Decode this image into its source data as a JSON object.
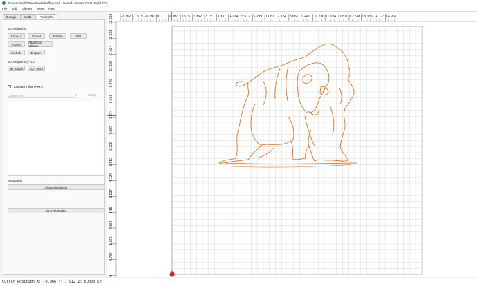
{
  "window": {
    "title": "C:\\Users\\willh\\Downloads\\buffalo.c2d - Carbide Create PRO, Build 774"
  },
  "menu": [
    "File",
    "Edit",
    "Library",
    "View",
    "Help"
  ],
  "tabs": [
    "Design",
    "Model",
    "Toolpaths"
  ],
  "toolpaths": {
    "section_2d": "2D Toolpaths",
    "buttons_2d": [
      "Contour",
      "Pocket",
      "Texture",
      "Drill",
      "VCarve",
      "Advanced VCarve",
      "Keyhole",
      "Engrave"
    ],
    "section_3d": "3D Toolpaths (PRO)",
    "buttons_3d": [
      "3D Rough",
      "3D Finish"
    ],
    "tiling_label": "Toolpath Tiling (PRO)",
    "current_tile": "Current Tile",
    "setup": "Setup",
    "simulation_label": "Simulation",
    "show_simulation": "Show Simulation",
    "save_toolpaths": "Save Toolpaths"
  },
  "ruler": {
    "x_labels": [
      "-2.362",
      "-1.575",
      "-0.787",
      "0",
      "0.787",
      "1.575",
      "2.362",
      "3.15",
      "3.937",
      "4.724",
      "5.512",
      "6.299",
      "7.087",
      "7.874",
      "8.661",
      "9.449",
      "10.236",
      "11.024",
      "11.811",
      "12.598",
      "13.386",
      "14.173",
      "14.961"
    ],
    "y_labels": [
      "12.598",
      "11.811",
      "11.024",
      "10.236",
      "9.449",
      "8.661",
      "7.874",
      "7.087",
      "6.299",
      "5.512",
      "4.724",
      "3.937",
      "3.15",
      "2.362",
      "1.575",
      "0.787",
      "0"
    ]
  },
  "status": {
    "cursor": "Cursor Position X: -0.066 Y: 7.912 Z: 0.000 in"
  },
  "colors": {
    "accent": "#e07020",
    "grid": "#cfcfcf",
    "origin": "#e02020"
  }
}
